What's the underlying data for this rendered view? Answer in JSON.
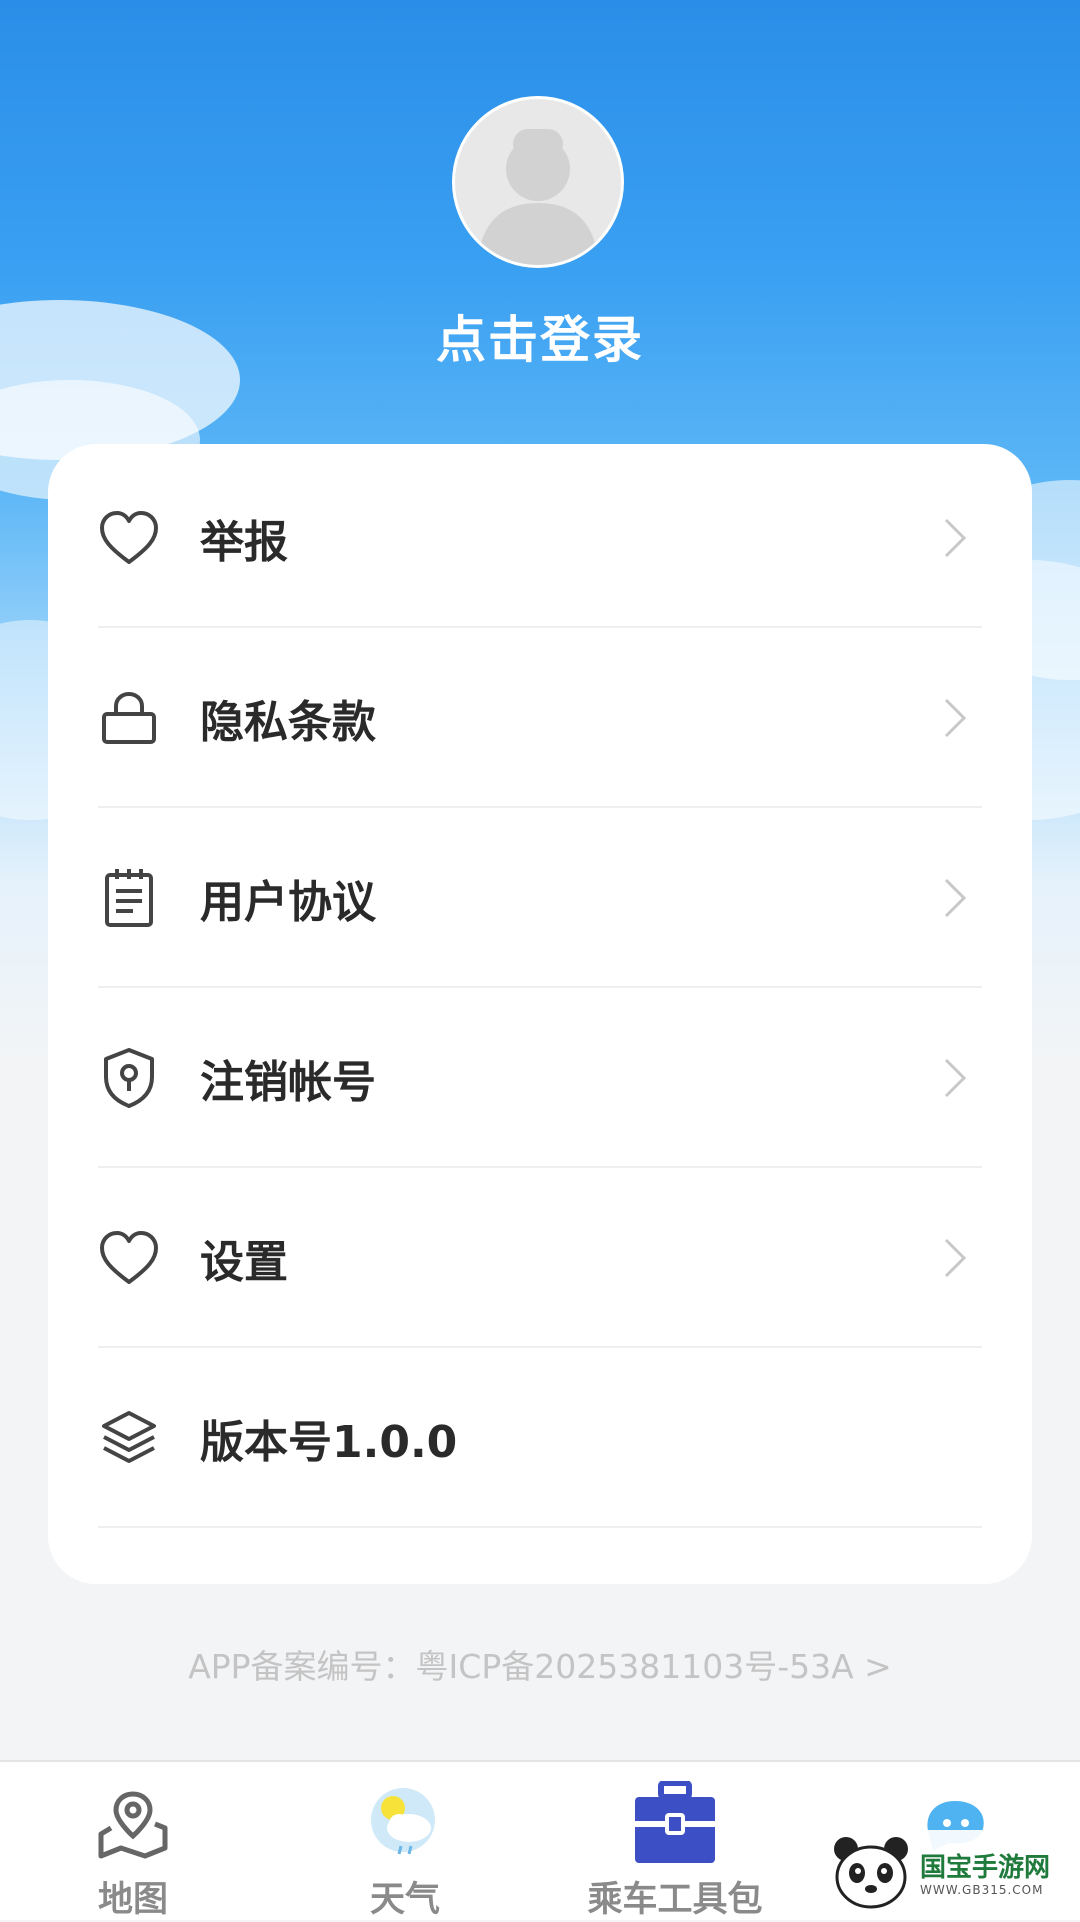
{
  "header": {
    "login_label": "点击登录"
  },
  "menu": {
    "items": [
      {
        "label": "举报",
        "icon": "heart-icon"
      },
      {
        "label": "隐私条款",
        "icon": "lock-icon"
      },
      {
        "label": "用户协议",
        "icon": "notepad-icon"
      },
      {
        "label": "注销帐号",
        "icon": "shield-keyhole-icon"
      },
      {
        "label": "设置",
        "icon": "heart-icon"
      },
      {
        "label": "版本号1.0.0",
        "icon": "layers-icon"
      }
    ]
  },
  "footer": {
    "icp": "APP备案编号：粤ICP备2025381103号-53A >"
  },
  "tabbar": {
    "tabs": [
      {
        "label": "地图",
        "icon": "map-pin-icon"
      },
      {
        "label": "天气",
        "icon": "weather-icon"
      },
      {
        "label": "乘车工具包",
        "icon": "toolbox-icon"
      },
      {
        "label": "",
        "icon": "chat-bubble-icon"
      }
    ]
  },
  "watermark": {
    "title": "国宝手游网",
    "sub": "WWW.GB315.COM"
  },
  "colors": {
    "sky_top": "#2a8ee8",
    "card_bg": "#ffffff",
    "text_dark": "#2a2a2a",
    "tab_active_icon": "#3d4fc4",
    "muted": "#c4c4c4"
  }
}
